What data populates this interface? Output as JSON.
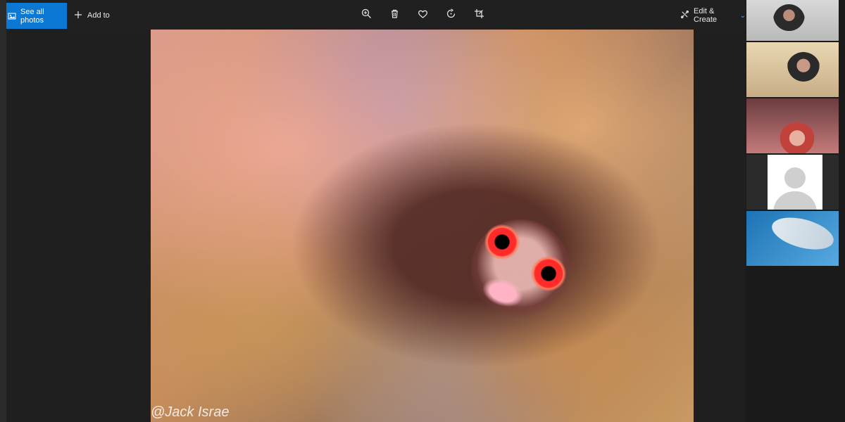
{
  "toolbar": {
    "see_all_photos": "See all photos",
    "add_to": "Add to",
    "edit_create": "Edit & Create",
    "icons": {
      "photos": "photos-icon",
      "plus": "plus-icon",
      "zoom": "zoom-in-icon",
      "delete": "trash-icon",
      "favorite": "heart-icon",
      "rotate": "rotate-icon",
      "crop": "crop-icon",
      "edit": "edit-create-icon",
      "chevron": "chevron-down-icon"
    }
  },
  "photo": {
    "watermark": "@Jack Israe"
  },
  "participants": {
    "count": 5,
    "tiles": [
      {
        "type": "video"
      },
      {
        "type": "video"
      },
      {
        "type": "video"
      },
      {
        "type": "avatar"
      },
      {
        "type": "video"
      }
    ]
  },
  "colors": {
    "accent": "#0b78d4",
    "toolbar_bg": "#202020",
    "app_bg": "#1f1f1f"
  }
}
